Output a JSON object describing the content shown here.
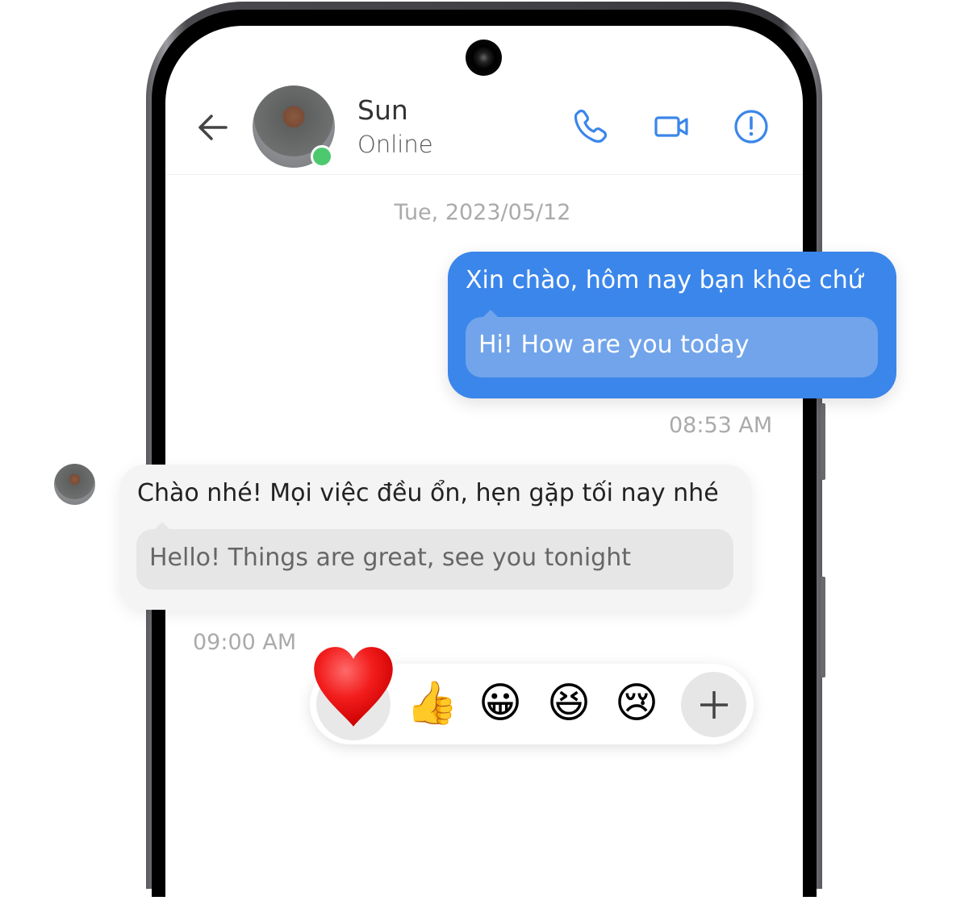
{
  "header": {
    "contact_name": "Sun",
    "status": "Online",
    "icons": [
      "back-arrow-icon",
      "phone-icon",
      "video-icon",
      "info-icon"
    ],
    "accent": "#3b86ea",
    "online_color": "#4cc96f"
  },
  "chat": {
    "date": "Tue, 2023/05/12",
    "messages": [
      {
        "direction": "sent",
        "text": "Xin chào, hôm nay bạn khỏe chứ",
        "translation": "Hi! How are you today",
        "time": "08:53 AM"
      },
      {
        "direction": "received",
        "text": "Chào nhé! Mọi việc đều ổn, hẹn gặp tối nay nhé",
        "translation": "Hello! Things are great, see you tonight",
        "time": "09:00 AM"
      }
    ]
  },
  "reactions": {
    "items": [
      {
        "name": "heart",
        "glyph": "❤️",
        "selected": true
      },
      {
        "name": "thumbs-up",
        "glyph": "👍"
      },
      {
        "name": "grinning",
        "glyph": "😀"
      },
      {
        "name": "laughing",
        "glyph": "😆"
      },
      {
        "name": "crying",
        "glyph": "😢"
      }
    ],
    "more": "+"
  }
}
